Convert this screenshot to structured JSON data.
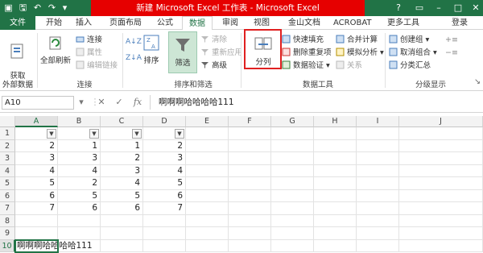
{
  "window": {
    "title": "新建 Microsoft Excel 工作表 - Microsoft Excel",
    "help": "?",
    "login": "登录"
  },
  "tabs": [
    "文件",
    "开始",
    "插入",
    "页面布局",
    "公式",
    "数据",
    "审阅",
    "视图",
    "金山文档",
    "ACROBAT",
    "更多工具"
  ],
  "ribbon": {
    "get_external": "获取\n外部数据",
    "refresh_all": "全部刷新",
    "connections": "连接",
    "properties": "属性",
    "edit_links": "编辑链接",
    "sort": "排序",
    "filter": "筛选",
    "clear": "清除",
    "reapply": "重新应用",
    "advanced": "高级",
    "text_to_columns": "分列",
    "flash_fill": "快速填充",
    "remove_duplicates": "删除重复项",
    "data_validation": "数据验证",
    "consolidate": "合并计算",
    "what_if": "模拟分析",
    "relationships": "关系",
    "group": "创建组",
    "ungroup": "取消组合",
    "subtotal": "分类汇总",
    "groups": {
      "connections": "连接",
      "sort_filter": "排序和筛选",
      "data_tools": "数据工具",
      "outline": "分级显示"
    }
  },
  "formula": {
    "namebox": "A10",
    "fx": "fx",
    "content": "啊啊啊哈哈哈哈111"
  },
  "columns": [
    "A",
    "B",
    "C",
    "D",
    "E",
    "F",
    "G",
    "H",
    "I",
    "J"
  ],
  "rows": [
    "1",
    "2",
    "3",
    "4",
    "5",
    "6",
    "7",
    "8",
    "9",
    "10"
  ],
  "cells": [
    [
      "2",
      "1",
      "1",
      "2"
    ],
    [
      "3",
      "3",
      "2",
      "3"
    ],
    [
      "4",
      "4",
      "3",
      "4"
    ],
    [
      "5",
      "2",
      "4",
      "5"
    ],
    [
      "6",
      "5",
      "5",
      "6"
    ],
    [
      "7",
      "6",
      "6",
      "7"
    ]
  ],
  "a10": "啊啊啊哈哈哈哈111",
  "dropdown_arrow": "▼"
}
